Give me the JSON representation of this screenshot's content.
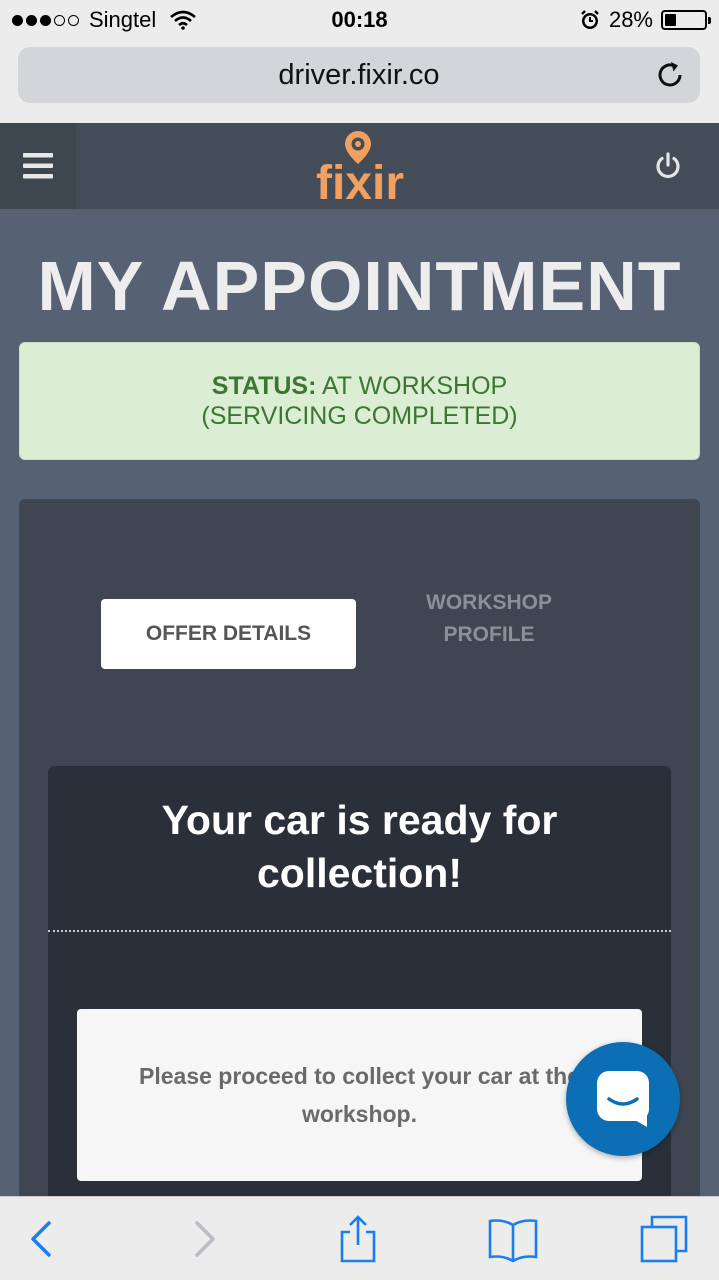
{
  "status_bar": {
    "carrier": "Singtel",
    "time": "00:18",
    "battery": "28%",
    "battery_level": 0.28
  },
  "browser": {
    "url": "driver.fixir.co"
  },
  "app": {
    "logo_text": "fixir",
    "brand_color": "#f0a060"
  },
  "page": {
    "title": "MY APPOINTMENT",
    "status_label": "STATUS:",
    "status_value": "AT WORKSHOP",
    "status_detail": "(SERVICING COMPLETED)"
  },
  "tabs": {
    "offer_details": "OFFER DETAILS",
    "workshop_profile_line1": "WORKSHOP",
    "workshop_profile_line2": "PROFILE"
  },
  "card": {
    "heading_line1": "Your car is ready for",
    "heading_line2": "collection!",
    "message": "Please proceed to collect your car at the workshop."
  },
  "icons": {
    "menu": "hamburger-icon",
    "power": "power-icon",
    "reload": "reload-icon",
    "chat": "chat-icon",
    "back": "back-icon",
    "forward": "forward-icon",
    "share": "share-icon",
    "bookmarks": "bookmarks-icon",
    "tabs": "tabs-icon"
  }
}
